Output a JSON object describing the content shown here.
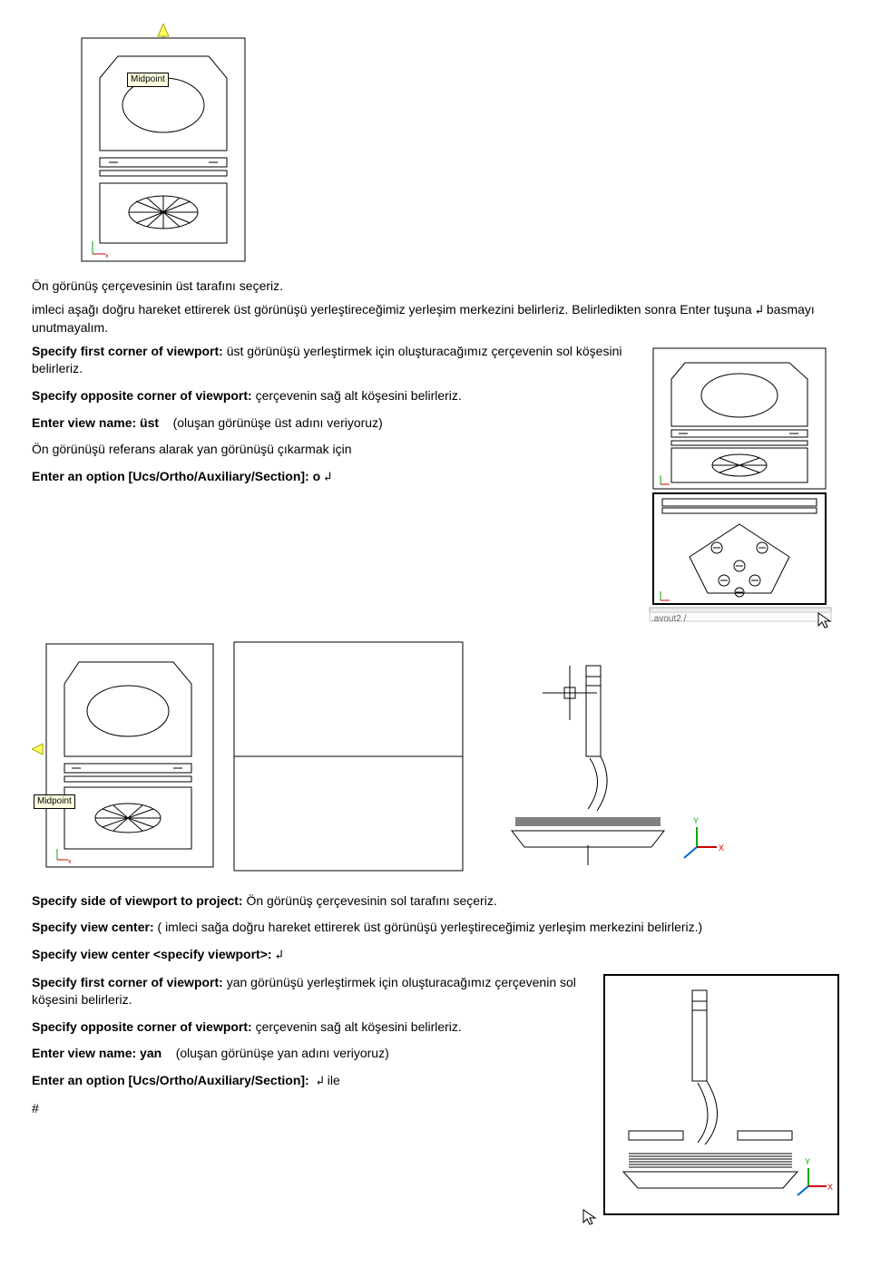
{
  "tooltip": {
    "midpoint": "Midpoint"
  },
  "p1": "Ön görünüş çerçevesinin üst tarafını seçeriz.",
  "p2_a": "imleci aşağı doğru hareket ettirerek üst görünüşü yerleştireceğimiz yerleşim merkezini belirleriz. Belirledikten sonra Enter tuşuna ",
  "p2_b": " basmayı unutmayalım.",
  "s1_label": "Specify first corner of viewport:",
  "s1_text": " üst görünüşü yerleştirmek için oluşturacağımız çerçevenin sol köşesini belirleriz.",
  "s2_label": "Specify opposite corner of viewport:",
  "s2_text": " çerçevenin sağ alt köşesini belirleriz.",
  "s3_a": "Enter view name: ",
  "s3_val": "üst",
  "s3_b": "(oluşan görünüşe üst adını veriyoruz)",
  "p3": "Ön görünüşü referans alarak yan görünüşü çıkarmak için",
  "s4_label": "Enter an option [Ucs/Ortho/Auxiliary/Section]: ",
  "s4_val": "o ",
  "tab_layout": ".avout2 /",
  "s5_label": "Specify side of viewport to project:",
  "s5_text": " Ön görünüş çerçevesinin sol tarafını seçeriz.",
  "s6_label": "Specify view center:",
  "s6_text": " ( imleci sağa doğru hareket ettirerek üst görünüşü yerleştireceğimiz yerleşim merkezini belirleriz.)",
  "s7_label": "Specify view center <specify viewport>: ",
  "s8_label": "Specify first corner of viewport:",
  "s8_text": " yan  görünüşü yerleştirmek için oluşturacağımız çerçevenin sol köşesini belirleriz.",
  "s9_label": "Specify opposite corner of viewport:",
  "s9_text": " çerçevenin sağ alt köşesini belirleriz.",
  "s10_a": "Enter view name: ",
  "s10_val": "yan",
  "s10_b": "(oluşan görünüşe yan adını veriyoruz)",
  "s11_label": "Enter an option [Ucs/Ortho/Auxiliary/Section]: ",
  "s11_b": " ile",
  "pagenum": "#",
  "enter": "↲"
}
